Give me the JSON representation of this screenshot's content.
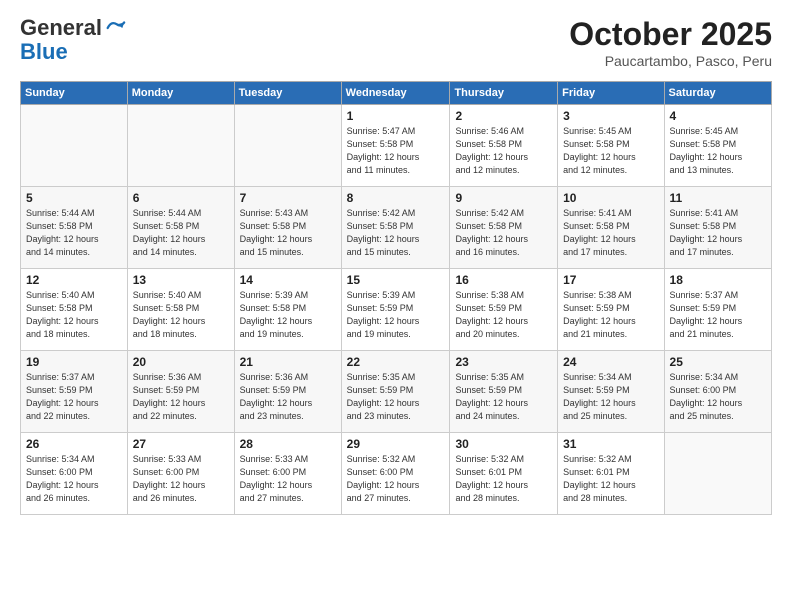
{
  "logo": {
    "general": "General",
    "blue": "Blue"
  },
  "header": {
    "month": "October 2025",
    "location": "Paucartambo, Pasco, Peru"
  },
  "weekdays": [
    "Sunday",
    "Monday",
    "Tuesday",
    "Wednesday",
    "Thursday",
    "Friday",
    "Saturday"
  ],
  "weeks": [
    [
      {
        "day": "",
        "info": ""
      },
      {
        "day": "",
        "info": ""
      },
      {
        "day": "",
        "info": ""
      },
      {
        "day": "1",
        "info": "Sunrise: 5:47 AM\nSunset: 5:58 PM\nDaylight: 12 hours\nand 11 minutes."
      },
      {
        "day": "2",
        "info": "Sunrise: 5:46 AM\nSunset: 5:58 PM\nDaylight: 12 hours\nand 12 minutes."
      },
      {
        "day": "3",
        "info": "Sunrise: 5:45 AM\nSunset: 5:58 PM\nDaylight: 12 hours\nand 12 minutes."
      },
      {
        "day": "4",
        "info": "Sunrise: 5:45 AM\nSunset: 5:58 PM\nDaylight: 12 hours\nand 13 minutes."
      }
    ],
    [
      {
        "day": "5",
        "info": "Sunrise: 5:44 AM\nSunset: 5:58 PM\nDaylight: 12 hours\nand 14 minutes."
      },
      {
        "day": "6",
        "info": "Sunrise: 5:44 AM\nSunset: 5:58 PM\nDaylight: 12 hours\nand 14 minutes."
      },
      {
        "day": "7",
        "info": "Sunrise: 5:43 AM\nSunset: 5:58 PM\nDaylight: 12 hours\nand 15 minutes."
      },
      {
        "day": "8",
        "info": "Sunrise: 5:42 AM\nSunset: 5:58 PM\nDaylight: 12 hours\nand 15 minutes."
      },
      {
        "day": "9",
        "info": "Sunrise: 5:42 AM\nSunset: 5:58 PM\nDaylight: 12 hours\nand 16 minutes."
      },
      {
        "day": "10",
        "info": "Sunrise: 5:41 AM\nSunset: 5:58 PM\nDaylight: 12 hours\nand 17 minutes."
      },
      {
        "day": "11",
        "info": "Sunrise: 5:41 AM\nSunset: 5:58 PM\nDaylight: 12 hours\nand 17 minutes."
      }
    ],
    [
      {
        "day": "12",
        "info": "Sunrise: 5:40 AM\nSunset: 5:58 PM\nDaylight: 12 hours\nand 18 minutes."
      },
      {
        "day": "13",
        "info": "Sunrise: 5:40 AM\nSunset: 5:58 PM\nDaylight: 12 hours\nand 18 minutes."
      },
      {
        "day": "14",
        "info": "Sunrise: 5:39 AM\nSunset: 5:58 PM\nDaylight: 12 hours\nand 19 minutes."
      },
      {
        "day": "15",
        "info": "Sunrise: 5:39 AM\nSunset: 5:59 PM\nDaylight: 12 hours\nand 19 minutes."
      },
      {
        "day": "16",
        "info": "Sunrise: 5:38 AM\nSunset: 5:59 PM\nDaylight: 12 hours\nand 20 minutes."
      },
      {
        "day": "17",
        "info": "Sunrise: 5:38 AM\nSunset: 5:59 PM\nDaylight: 12 hours\nand 21 minutes."
      },
      {
        "day": "18",
        "info": "Sunrise: 5:37 AM\nSunset: 5:59 PM\nDaylight: 12 hours\nand 21 minutes."
      }
    ],
    [
      {
        "day": "19",
        "info": "Sunrise: 5:37 AM\nSunset: 5:59 PM\nDaylight: 12 hours\nand 22 minutes."
      },
      {
        "day": "20",
        "info": "Sunrise: 5:36 AM\nSunset: 5:59 PM\nDaylight: 12 hours\nand 22 minutes."
      },
      {
        "day": "21",
        "info": "Sunrise: 5:36 AM\nSunset: 5:59 PM\nDaylight: 12 hours\nand 23 minutes."
      },
      {
        "day": "22",
        "info": "Sunrise: 5:35 AM\nSunset: 5:59 PM\nDaylight: 12 hours\nand 23 minutes."
      },
      {
        "day": "23",
        "info": "Sunrise: 5:35 AM\nSunset: 5:59 PM\nDaylight: 12 hours\nand 24 minutes."
      },
      {
        "day": "24",
        "info": "Sunrise: 5:34 AM\nSunset: 5:59 PM\nDaylight: 12 hours\nand 25 minutes."
      },
      {
        "day": "25",
        "info": "Sunrise: 5:34 AM\nSunset: 6:00 PM\nDaylight: 12 hours\nand 25 minutes."
      }
    ],
    [
      {
        "day": "26",
        "info": "Sunrise: 5:34 AM\nSunset: 6:00 PM\nDaylight: 12 hours\nand 26 minutes."
      },
      {
        "day": "27",
        "info": "Sunrise: 5:33 AM\nSunset: 6:00 PM\nDaylight: 12 hours\nand 26 minutes."
      },
      {
        "day": "28",
        "info": "Sunrise: 5:33 AM\nSunset: 6:00 PM\nDaylight: 12 hours\nand 27 minutes."
      },
      {
        "day": "29",
        "info": "Sunrise: 5:32 AM\nSunset: 6:00 PM\nDaylight: 12 hours\nand 27 minutes."
      },
      {
        "day": "30",
        "info": "Sunrise: 5:32 AM\nSunset: 6:01 PM\nDaylight: 12 hours\nand 28 minutes."
      },
      {
        "day": "31",
        "info": "Sunrise: 5:32 AM\nSunset: 6:01 PM\nDaylight: 12 hours\nand 28 minutes."
      },
      {
        "day": "",
        "info": ""
      }
    ]
  ]
}
